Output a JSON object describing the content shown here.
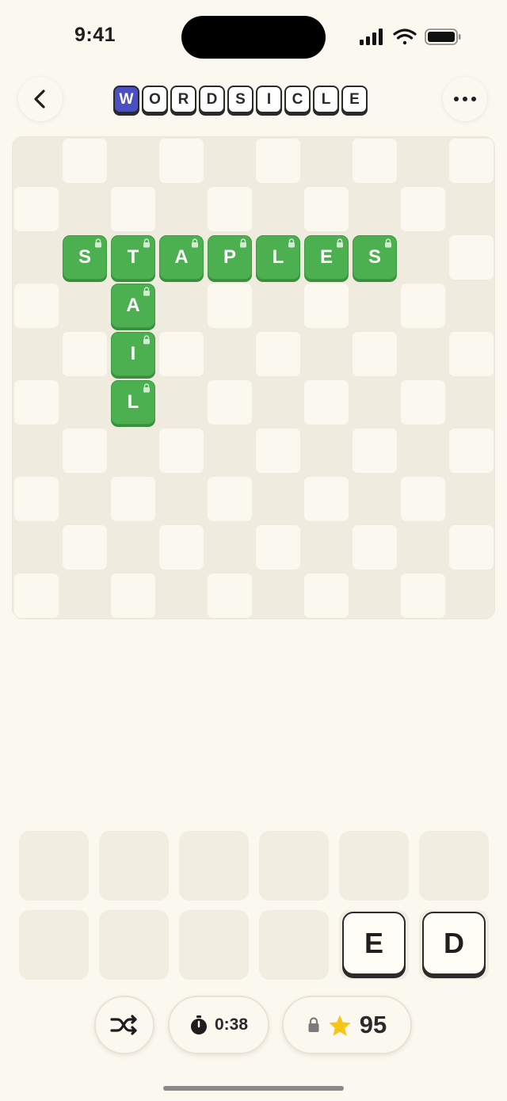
{
  "status_bar": {
    "time": "9:41"
  },
  "header": {
    "back_icon": "chevron-left-icon",
    "more_icon": "ellipsis-icon",
    "logo_letters": [
      "W",
      "O",
      "R",
      "D",
      "S",
      "I",
      "C",
      "L",
      "E"
    ]
  },
  "board": {
    "grid_size": 10,
    "placed_tiles": [
      {
        "letter": "S",
        "row": 2,
        "col": 1,
        "locked": true
      },
      {
        "letter": "T",
        "row": 2,
        "col": 2,
        "locked": true
      },
      {
        "letter": "A",
        "row": 2,
        "col": 3,
        "locked": true
      },
      {
        "letter": "P",
        "row": 2,
        "col": 4,
        "locked": true
      },
      {
        "letter": "L",
        "row": 2,
        "col": 5,
        "locked": true
      },
      {
        "letter": "E",
        "row": 2,
        "col": 6,
        "locked": true
      },
      {
        "letter": "S",
        "row": 2,
        "col": 7,
        "locked": true
      },
      {
        "letter": "A",
        "row": 3,
        "col": 2,
        "locked": true
      },
      {
        "letter": "I",
        "row": 4,
        "col": 2,
        "locked": true
      },
      {
        "letter": "L",
        "row": 5,
        "col": 2,
        "locked": true
      }
    ],
    "tile_color": "#4caf50"
  },
  "rack": {
    "slot_count": 12,
    "tiles": [
      {
        "letter": "E",
        "slot": 10
      },
      {
        "letter": "D",
        "slot": 11
      }
    ]
  },
  "controls": {
    "shuffle_icon": "shuffle-icon",
    "timer_icon": "stopwatch-icon",
    "timer_value": "0:38",
    "score_lock_icon": "lock-icon",
    "score_star_icon": "star-icon",
    "score_value": "95",
    "star_color": "#f5c518"
  }
}
